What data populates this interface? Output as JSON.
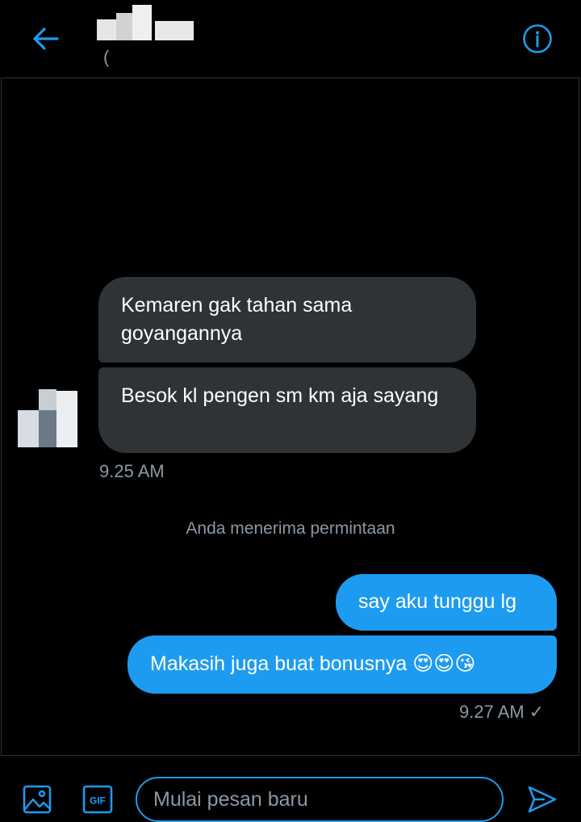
{
  "header": {
    "handle_partial": "(",
    "back_icon": "arrow-left-icon",
    "info_icon": "info-circle-icon"
  },
  "messages": {
    "received": [
      {
        "text": "Kemaren gak tahan sama goyangannya"
      },
      {
        "text": "Besok kl  pengen sm km aja sayang"
      }
    ],
    "received_time": "9.25 AM",
    "system_note": "Anda menerima permintaan",
    "sent": [
      {
        "text": "say aku tunggu lg"
      },
      {
        "text": "Makasih juga buat bonusnya 😍😍😘"
      }
    ],
    "sent_time": "9.27 AM",
    "sent_status": "✓"
  },
  "composer": {
    "placeholder": "Mulai pesan baru",
    "media_icon": "image-icon",
    "gif_label": "GIF",
    "send_icon": "send-icon"
  },
  "colors": {
    "accent": "#1d9bf0",
    "received_bubble": "#2f3336",
    "muted_text": "#8b98a5",
    "background": "#000000"
  }
}
